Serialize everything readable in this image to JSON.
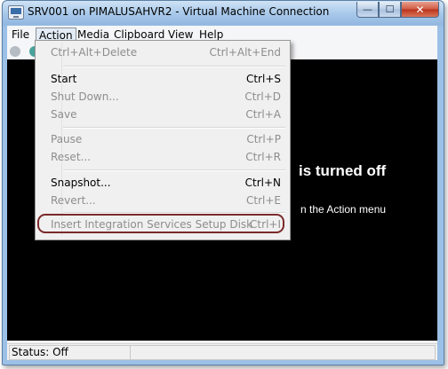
{
  "window": {
    "title": "SRV001 on PIMALUSAHVR2 - Virtual Machine Connection",
    "minimize_glyph": "—",
    "maximize_glyph": "☐",
    "close_glyph": "✕"
  },
  "menubar": {
    "items": [
      {
        "label": "File"
      },
      {
        "label": "Action"
      },
      {
        "label": "Media"
      },
      {
        "label": "Clipboard"
      },
      {
        "label": "View"
      },
      {
        "label": "Help"
      }
    ]
  },
  "action_menu": {
    "items": [
      {
        "label": "Ctrl+Alt+Delete",
        "shortcut": "Ctrl+Alt+End",
        "enabled": false
      },
      {
        "label": "Start",
        "shortcut": "Ctrl+S",
        "enabled": true
      },
      {
        "label": "Shut Down...",
        "shortcut": "Ctrl+D",
        "enabled": false
      },
      {
        "label": "Save",
        "shortcut": "Ctrl+A",
        "enabled": false
      },
      {
        "label": "Pause",
        "shortcut": "Ctrl+P",
        "enabled": false
      },
      {
        "label": "Reset...",
        "shortcut": "Ctrl+R",
        "enabled": false
      },
      {
        "label": "Snapshot...",
        "shortcut": "Ctrl+N",
        "enabled": true
      },
      {
        "label": "Revert...",
        "shortcut": "Ctrl+E",
        "enabled": false
      },
      {
        "label": "Insert Integration Services Setup Disk",
        "shortcut": "Ctrl+I",
        "enabled": false
      }
    ]
  },
  "screen": {
    "status_message": "is turned off",
    "hint_message": "n the Action menu"
  },
  "statusbar": {
    "text": "Status: Off"
  }
}
